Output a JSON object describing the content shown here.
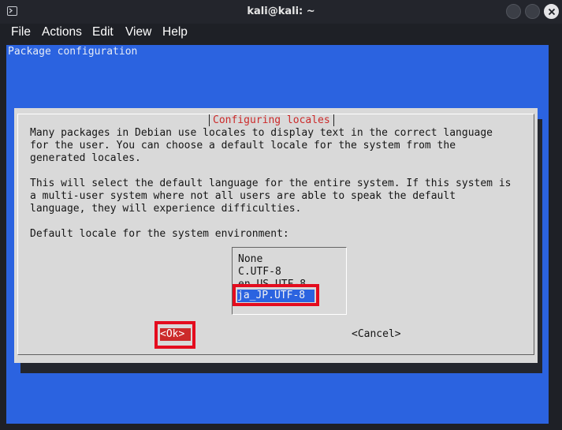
{
  "window": {
    "title": "kali@kali: ~"
  },
  "menu": {
    "items": [
      "File",
      "Actions",
      "Edit",
      "View",
      "Help"
    ]
  },
  "terminal": {
    "backtitle": "Package configuration"
  },
  "dialog": {
    "title": "Configuring locales",
    "description": "Many packages in Debian use locales to display text in the correct language\nfor the user. You can choose a default locale for the system from the\ngenerated locales.\n\nThis will select the default language for the entire system. If this system is\na multi-user system where not all users are able to speak the default\nlanguage, they will experience difficulties.\n\nDefault locale for the system environment:",
    "options": [
      "None",
      "C.UTF-8",
      "en_US.UTF-8",
      "ja_JP.UTF-8"
    ],
    "selected": "ja_JP.UTF-8",
    "ok_label": "<Ok>",
    "cancel_label": "<Cancel>"
  },
  "colors": {
    "terminal_bg": "#2b63e0",
    "dialog_bg": "#d9d9d9",
    "title_red": "#cc2a2a",
    "highlight_red": "#e40c1e"
  }
}
